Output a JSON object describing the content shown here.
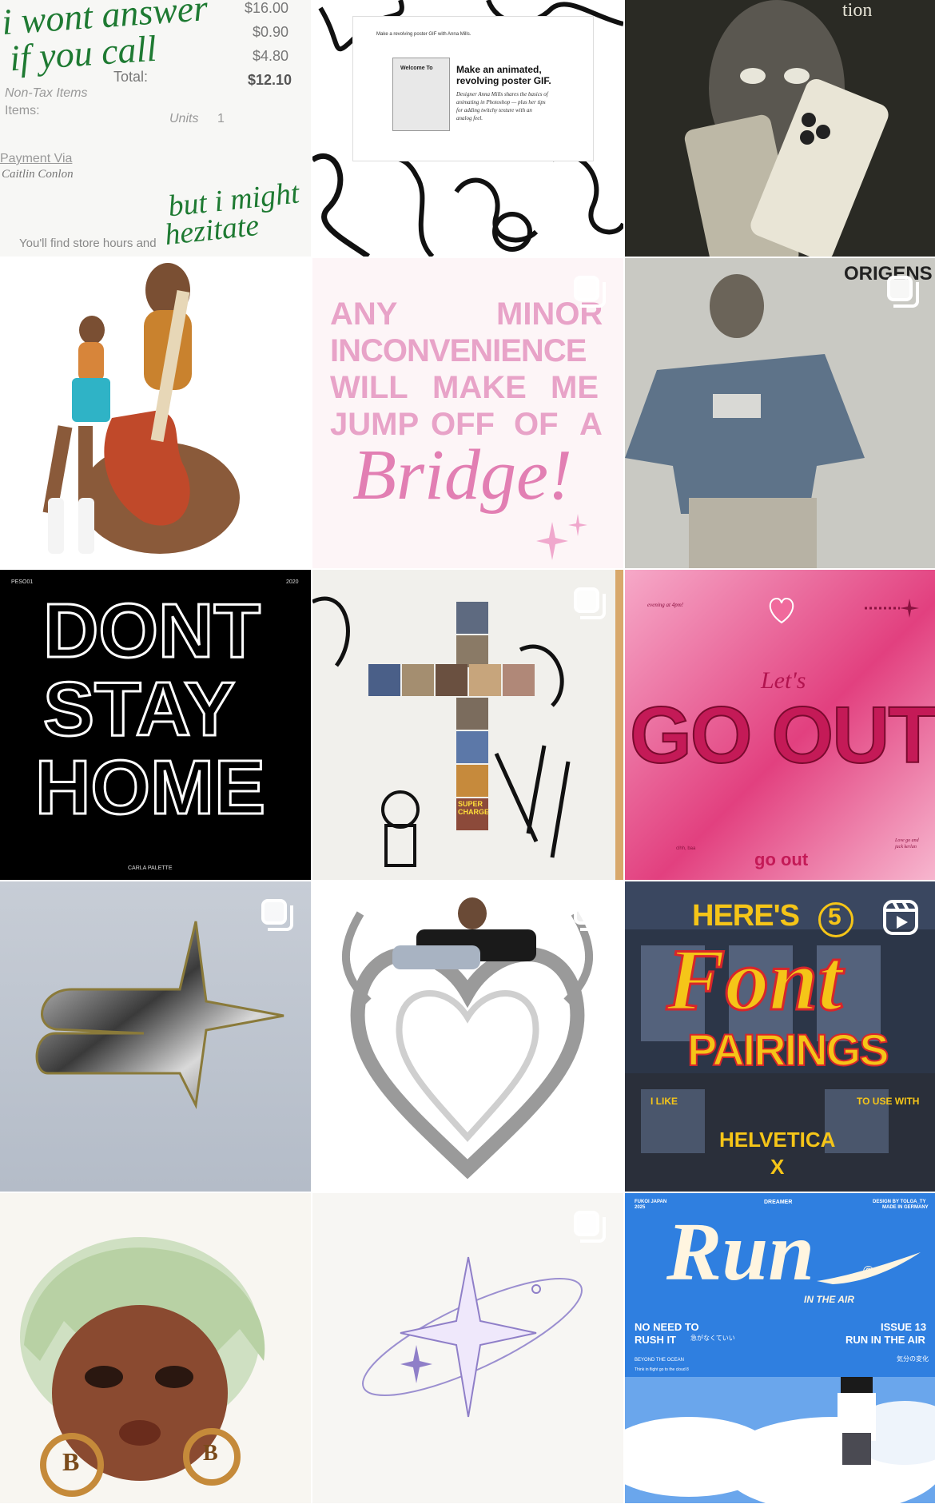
{
  "posts": [
    {
      "id": "receipt",
      "handwriting_top_1": "i wont answer",
      "handwriting_top_2": "if you call",
      "handwriting_bottom_1": "but i might",
      "handwriting_bottom_2": "hezitate",
      "prices": [
        "$16.00",
        "$0.90",
        "$4.80"
      ],
      "total_label": "Total:",
      "total_value": "$12.10",
      "non_tax_label": "Non-Tax Items",
      "items_label": "Items:",
      "units_label": "Units",
      "units_value": "1",
      "payment_label": "Payment Via",
      "payment_value": "Caitlin Conlon",
      "footer_text": "You'll find store hours and",
      "ink_color": "#1e7a32"
    },
    {
      "id": "poster-gif",
      "headline_1": "Make an animated,",
      "headline_2": "revolving poster GIF.",
      "body_1": "Designer Anna Mills shares the basics of",
      "body_2": "animating in Photoshop — plus her tips",
      "body_3": "for adding twitchy texture with an",
      "body_4": "analog feel.",
      "nav_text": "Make a revolving poster GIF with Anna Mills.",
      "poster_title": "Welcome To"
    },
    {
      "id": "phone-face",
      "corner_text": "tion"
    },
    {
      "id": "guitar-girl"
    },
    {
      "id": "minor-inconvenience",
      "line_1a": "ANY",
      "line_1b": "MINOR",
      "line_2": "INCONVENIENCE",
      "line_3a": "WILL",
      "line_3b": "MAKE",
      "line_3c": "ME",
      "line_4a": "JUMP",
      "line_4b": "OFF",
      "line_4c": "OF",
      "line_4d": "A",
      "script_word": "Bridge!",
      "pink": "#e8a3c8"
    },
    {
      "id": "origens",
      "brand": "ORIGENS"
    },
    {
      "id": "dont-stay-home",
      "corner_left": "PESO01",
      "corner_right": "2020",
      "line_1": "DONT",
      "line_2": "STAY",
      "line_3": "HOME",
      "credit": "CARLA PALETTE"
    },
    {
      "id": "collage-cross",
      "sticker_text": "SUPER CHARGE"
    },
    {
      "id": "lets-go-out",
      "small_script": "Let's",
      "main_text": "GO OUT",
      "top_left": "evening at 4pm!",
      "bottom_right_1": "Love go and",
      "bottom_right_2": "jack kerlan",
      "bottom_left": "clhh, baa",
      "bottom_center": "go out"
    },
    {
      "id": "chrome-star"
    },
    {
      "id": "chrome-heart"
    },
    {
      "id": "font-pairings",
      "line_1a": "HERE'S",
      "circle_number": "5",
      "script": "Font",
      "line_2": "PAIRINGS",
      "left_small": "I LIKE",
      "right_small": "TO USE WITH",
      "font_name": "HELVETICA",
      "cross": "X",
      "yellow": "#f5c518",
      "red": "#d7262a"
    },
    {
      "id": "clay-face",
      "hoop_left": "B",
      "hoop_right": "B"
    },
    {
      "id": "sparkle-star"
    },
    {
      "id": "run-poster",
      "top_left_1": "FUKOI JAPAN",
      "top_left_2": "2025",
      "top_center": "DREAMER",
      "top_right_1": "DESIGN BY TOLGA_TY",
      "top_right_2": "MADE IN GERMANY",
      "title": "Run",
      "registered": "©",
      "subtitle": "IN THE AIR",
      "left_1": "NO NEED TO",
      "left_2": "RUSH IT",
      "left_jp": "急がなくていい",
      "left_small": "BEYOND THE OCEAN",
      "left_tiny": "Think in flight go to the cloud 8",
      "right_1": "ISSUE 13",
      "right_2": "RUN IN THE AIR",
      "right_jp": "気分の変化",
      "blue": "#2f7fe0"
    }
  ]
}
